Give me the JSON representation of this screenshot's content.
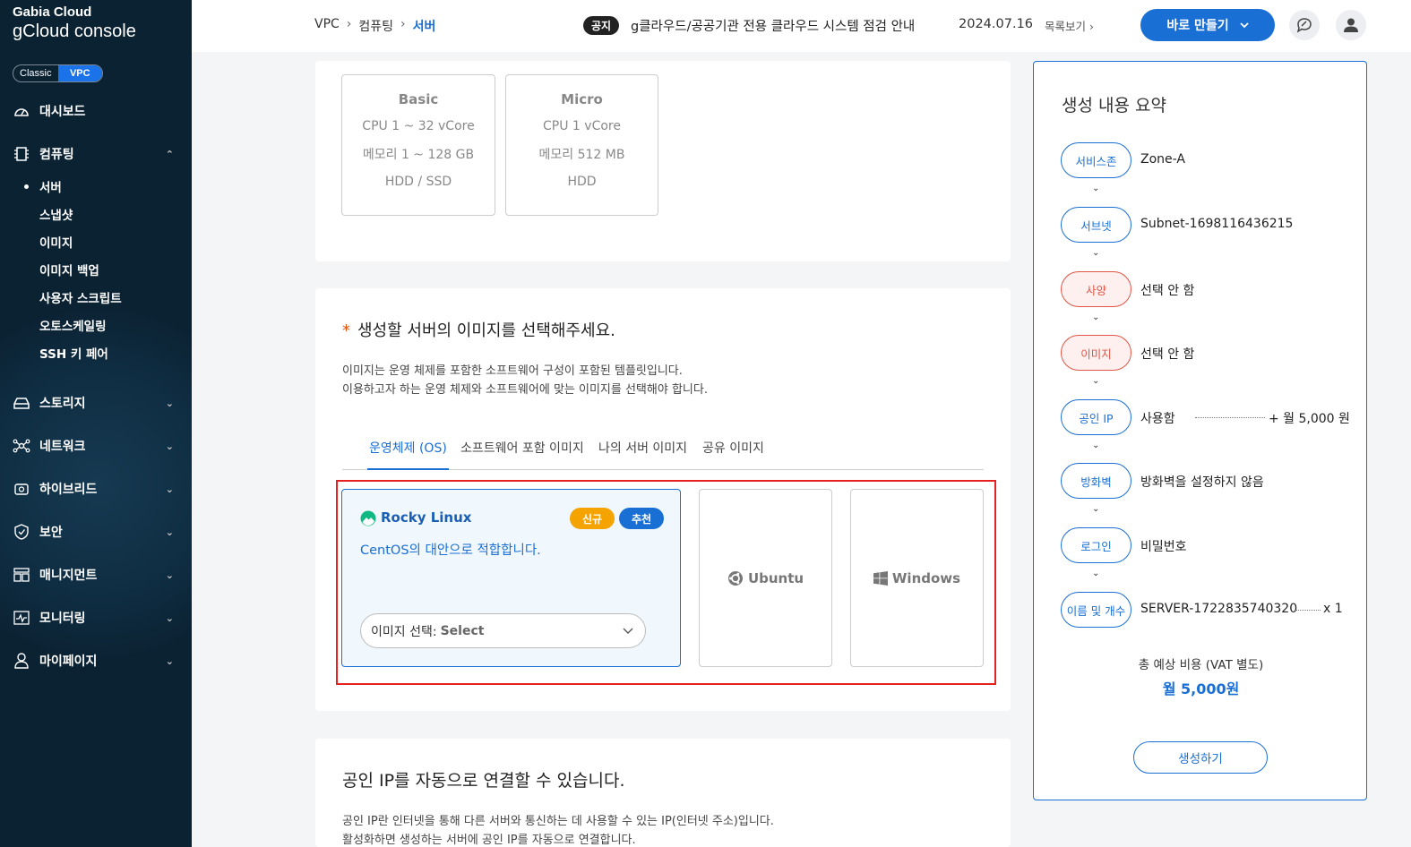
{
  "brand": {
    "line1": "Gabia Cloud",
    "line2": "gCloud console"
  },
  "toggle": {
    "classic": "Classic",
    "vpc": "VPC"
  },
  "sidebar": {
    "items": [
      {
        "label": "대시보드",
        "icon": "dashboard-icon"
      },
      {
        "label": "컴퓨팅",
        "icon": "chip-icon",
        "expanded": true
      },
      {
        "label": "스토리지",
        "icon": "storage-icon"
      },
      {
        "label": "네트워크",
        "icon": "network-icon"
      },
      {
        "label": "하이브리드",
        "icon": "hybrid-icon"
      },
      {
        "label": "보안",
        "icon": "shield-icon"
      },
      {
        "label": "매니지먼트",
        "icon": "management-icon"
      },
      {
        "label": "모니터링",
        "icon": "monitoring-icon"
      },
      {
        "label": "마이페이지",
        "icon": "user-icon"
      }
    ],
    "compute_sub": [
      "서버",
      "스냅샷",
      "이미지",
      "이미지 백업",
      "사용자 스크립트",
      "오토스케일링",
      "SSH 키 페어"
    ]
  },
  "header": {
    "breadcrumb": [
      "VPC",
      "컴퓨팅",
      "서버"
    ],
    "notice_badge": "공지",
    "notice_text": "g클라우드/공공기관 전용 클라우드 시스템 점검 안내",
    "notice_date": "2024.07.16",
    "notice_more": "목록보기",
    "create_button": "바로 만들기"
  },
  "specs": [
    {
      "title": "Basic",
      "cpu": "CPU 1 ~ 32 vCore",
      "mem": "메모리 1 ~ 128 GB",
      "disk": "HDD / SSD"
    },
    {
      "title": "Micro",
      "cpu": "CPU 1 vCore",
      "mem": "메모리 512 MB",
      "disk": "HDD"
    }
  ],
  "image_section": {
    "required_mark": "*",
    "title": "생성할 서버의 이미지를 선택해주세요.",
    "desc1": "이미지는 운영 체제를 포함한 소프트웨어 구성이 포함된 템플릿입니다.",
    "desc2": "이용하고자 하는 운영 체제와 소프트웨어에 맞는 이미지를 선택해야 합니다.",
    "tabs": [
      "운영체제 (OS)",
      "소프트웨어 포함 이미지",
      "나의 서버 이미지",
      "공유 이미지"
    ],
    "selected_os": {
      "name": "Rocky Linux",
      "badge_new": "신규",
      "badge_recommend": "추천",
      "description": "CentOS의 대안으로 적합합니다.",
      "select_label": "이미지 선택:",
      "select_value": "Select"
    },
    "other_os": [
      "Ubuntu",
      "Windows"
    ]
  },
  "public_ip": {
    "title": "공인 IP를 자동으로 연결할 수 있습니다.",
    "desc1": "공인 IP란 인터넷을 통해 다른 서버와 통신하는 데 사용할 수 있는 IP(인터넷 주소)입니다.",
    "desc2": "활성화하면 생성하는 서버에 공인 IP를 자동으로 연결합니다."
  },
  "summary": {
    "title": "생성 내용 요약",
    "steps": [
      {
        "label": "서비스존",
        "value": "Zone-A",
        "warn": false
      },
      {
        "label": "서브넷",
        "value": "Subnet-1698116436215",
        "warn": false
      },
      {
        "label": "사양",
        "value": "선택 안 함",
        "warn": true
      },
      {
        "label": "이미지",
        "value": "선택 안 함",
        "warn": true
      },
      {
        "label": "공인 IP",
        "value": "사용함",
        "extra": "+ 월 5,000 원",
        "warn": false
      },
      {
        "label": "방화벽",
        "value": "방화벽을 설정하지 않음",
        "warn": false
      },
      {
        "label": "로그인",
        "value": "비밀번호",
        "warn": false
      },
      {
        "label": "이름 및 개수",
        "value": "SERVER-1722835740320",
        "extra": "x 1",
        "warn": false
      }
    ],
    "total_label": "총 예상 비용 (VAT 별도)",
    "total_value": "월 5,000원",
    "create_button": "생성하기"
  },
  "colors": {
    "accent": "#1a6fd4",
    "sidebar_bg": "#0b2233",
    "warn": "#e05545",
    "badge_new": "#f5a300",
    "frame": "#e52222"
  }
}
